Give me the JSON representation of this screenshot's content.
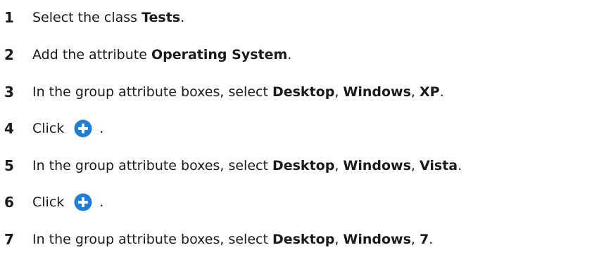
{
  "steps": [
    {
      "number": "1",
      "parts": [
        {
          "text": "Select the class ",
          "bold": false
        },
        {
          "text": "Tests",
          "bold": true
        },
        {
          "text": ".",
          "bold": false
        }
      ]
    },
    {
      "number": "2",
      "parts": [
        {
          "text": "Add the attribute ",
          "bold": false
        },
        {
          "text": "Operating System",
          "bold": true
        },
        {
          "text": ".",
          "bold": false
        }
      ]
    },
    {
      "number": "3",
      "parts": [
        {
          "text": "In the group attribute boxes, select ",
          "bold": false
        },
        {
          "text": "Desktop",
          "bold": true
        },
        {
          "text": ", ",
          "bold": false
        },
        {
          "text": "Windows",
          "bold": true
        },
        {
          "text": ", ",
          "bold": false
        },
        {
          "text": "XP",
          "bold": true
        },
        {
          "text": ".",
          "bold": false
        }
      ]
    },
    {
      "number": "4",
      "parts": [
        {
          "text": "Click",
          "bold": false
        },
        {
          "icon": "add-circle-icon"
        },
        {
          "text": ".",
          "bold": false
        }
      ]
    },
    {
      "number": "5",
      "parts": [
        {
          "text": "In the group attribute boxes, select ",
          "bold": false
        },
        {
          "text": "Desktop",
          "bold": true
        },
        {
          "text": ", ",
          "bold": false
        },
        {
          "text": "Windows",
          "bold": true
        },
        {
          "text": ", ",
          "bold": false
        },
        {
          "text": "Vista",
          "bold": true
        },
        {
          "text": ".",
          "bold": false
        }
      ]
    },
    {
      "number": "6",
      "parts": [
        {
          "text": "Click",
          "bold": false
        },
        {
          "icon": "add-circle-icon"
        },
        {
          "text": ".",
          "bold": false
        }
      ]
    },
    {
      "number": "7",
      "parts": [
        {
          "text": "In the group attribute boxes, select ",
          "bold": false
        },
        {
          "text": "Desktop",
          "bold": true
        },
        {
          "text": ", ",
          "bold": false
        },
        {
          "text": "Windows",
          "bold": true
        },
        {
          "text": ", ",
          "bold": false
        },
        {
          "text": "7",
          "bold": true
        },
        {
          "text": ".",
          "bold": false
        }
      ]
    }
  ],
  "colors": {
    "text": "#1a1a1a",
    "icon_fill": "#1e7fd8",
    "icon_glyph": "#ffffff"
  }
}
